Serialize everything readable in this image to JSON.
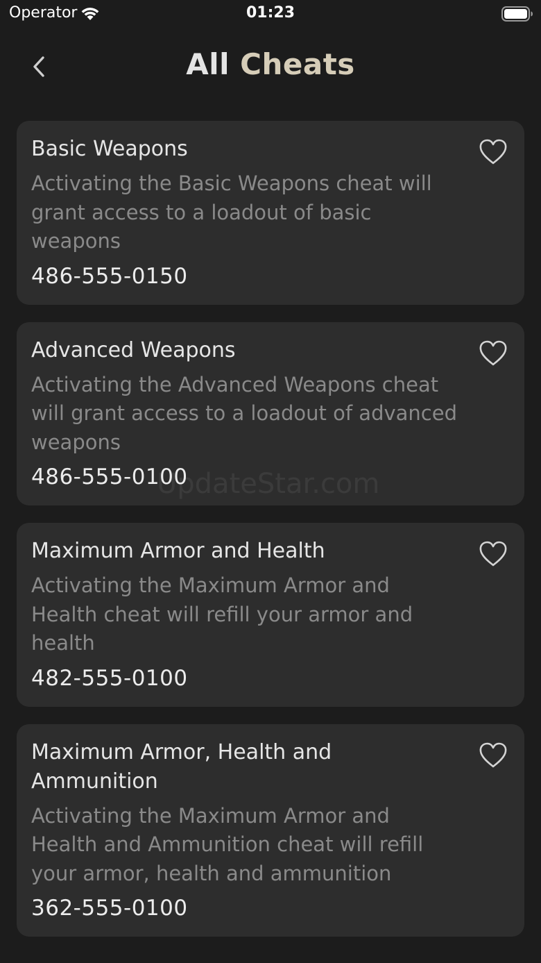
{
  "status_bar": {
    "carrier": "Operator",
    "time": "01:23"
  },
  "nav": {
    "title_part1": "All ",
    "title_part2": "Cheats",
    "title_color_primary": "#e4e4e4",
    "title_color_accent": "#d6cdb8"
  },
  "cheats": [
    {
      "title": "Basic Weapons",
      "description": "Activating the Basic Weapons cheat will grant access to a loadout of basic weapons",
      "code": "486-555-0150"
    },
    {
      "title": "Advanced Weapons",
      "description": "Activating the Advanced Weapons cheat will grant access to a loadout of advanced weapons",
      "code": "486-555-0100"
    },
    {
      "title": "Maximum Armor and Health",
      "description": "Activating the Maximum Armor and Health cheat will refill your armor and health",
      "code": "482-555-0100"
    },
    {
      "title": "Maximum Armor, Health and Ammunition",
      "description": "Activating the Maximum Armor and Health and Ammunition cheat will refill your armor, health and ammunition",
      "code": "362-555-0100"
    }
  ],
  "watermark": "UpdateStar.com",
  "colors": {
    "background": "#1c1c1c",
    "card": "#2d2d2d",
    "description_text": "#8a8a8a"
  }
}
